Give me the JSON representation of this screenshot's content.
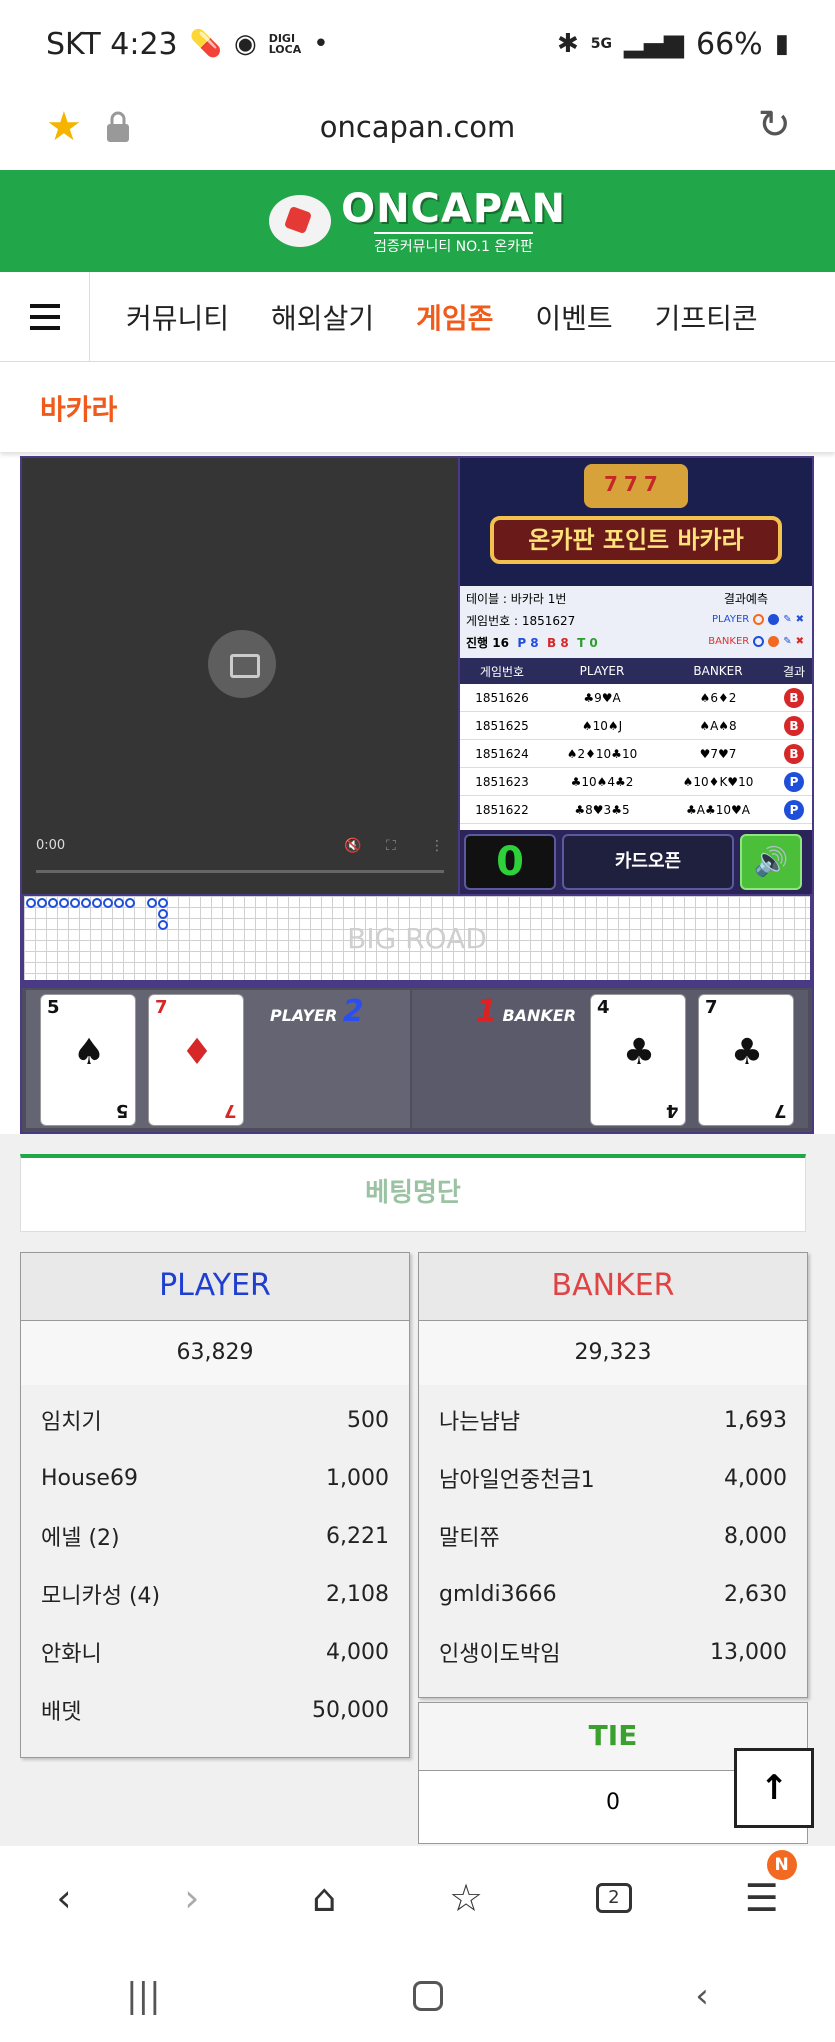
{
  "status_bar": {
    "carrier_time": "SKT 4:23",
    "digi_top": "DIGI",
    "digi_bottom": "LOCA",
    "dot": "•",
    "battery": "66%",
    "icons": [
      "pill-icon",
      "nfc-icon",
      "bluetooth-icon",
      "5g-icon",
      "signal-icon",
      "battery-icon"
    ]
  },
  "url_bar": {
    "url": "oncapan.com"
  },
  "site": {
    "logo_main": "ONCAPAN",
    "logo_sub": "검증커뮤니티 NO.1 온카판"
  },
  "nav": {
    "items": [
      "커뮤니티",
      "해외살기",
      "게임존",
      "이벤트",
      "기프티콘"
    ],
    "active_index": 2
  },
  "section_title": "바카라",
  "video": {
    "time": "0:00"
  },
  "game_panel": {
    "banner_title": "온카판 포인트 바카라",
    "table": "테이블 : 바카라 1번",
    "result_predict": "결과예측",
    "game_number": "게임번호 : 1851627",
    "progress": "진행 16",
    "p_count": "P 8",
    "b_count": "B 8",
    "t_count": "T 0",
    "pred_player": "PLAYER",
    "pred_banker": "BANKER"
  },
  "results": {
    "headers": [
      "게임번호",
      "PLAYER",
      "BANKER",
      "결과"
    ],
    "rows": [
      {
        "no": "1851626",
        "player": "♣9♥A",
        "banker": "♠6♦2",
        "result": "B"
      },
      {
        "no": "1851625",
        "player": "♠10♠J",
        "banker": "♠A♠8",
        "result": "B"
      },
      {
        "no": "1851624",
        "player": "♠2♦10♣10",
        "banker": "♥7♥7",
        "result": "B"
      },
      {
        "no": "1851623",
        "player": "♣10♠4♣2",
        "banker": "♠10♦K♥10",
        "result": "P"
      },
      {
        "no": "1851622",
        "player": "♣8♥3♣5",
        "banker": "♣A♣10♥A",
        "result": "P"
      }
    ]
  },
  "controls": {
    "count": "0",
    "card_open": "카드오픈"
  },
  "big_road": {
    "label": "BIG ROAD"
  },
  "table_cards": {
    "player_label": "PLAYER",
    "player_score": "2",
    "banker_label": "BANKER",
    "banker_score": "1",
    "player_cards": [
      {
        "rank": "5",
        "suit": "♠",
        "color": "black"
      },
      {
        "rank": "7",
        "suit": "♦",
        "color": "red"
      }
    ],
    "banker_cards": [
      {
        "rank": "4",
        "suit": "♣",
        "color": "black"
      },
      {
        "rank": "7",
        "suit": "♣",
        "color": "black"
      }
    ]
  },
  "betting": {
    "title": "베팅명단",
    "player": {
      "label": "PLAYER",
      "total": "63,829",
      "color": "#1f3fd0",
      "rows": [
        {
          "name": "임치기",
          "amount": "500"
        },
        {
          "name": "House69",
          "amount": "1,000"
        },
        {
          "name": "에넬 (2)",
          "amount": "6,221"
        },
        {
          "name": "모니카성 (4)",
          "amount": "2,108"
        },
        {
          "name": "안화니",
          "amount": "4,000"
        },
        {
          "name": "배뎃",
          "amount": "50,000"
        }
      ]
    },
    "banker": {
      "label": "BANKER",
      "total": "29,323",
      "color": "#e04343",
      "rows": [
        {
          "name": "나는냠냠",
          "amount": "1,693"
        },
        {
          "name": "남아일언중천금1",
          "amount": "4,000"
        },
        {
          "name": "말티쮸",
          "amount": "8,000"
        },
        {
          "name": "gmldi3666",
          "amount": "2,630"
        },
        {
          "name": "인생이도박임",
          "amount": "13,000"
        }
      ]
    },
    "tie": {
      "label": "TIE",
      "total": "0"
    }
  },
  "browser_nav": {
    "tabs_count": "2",
    "badge": "N"
  }
}
